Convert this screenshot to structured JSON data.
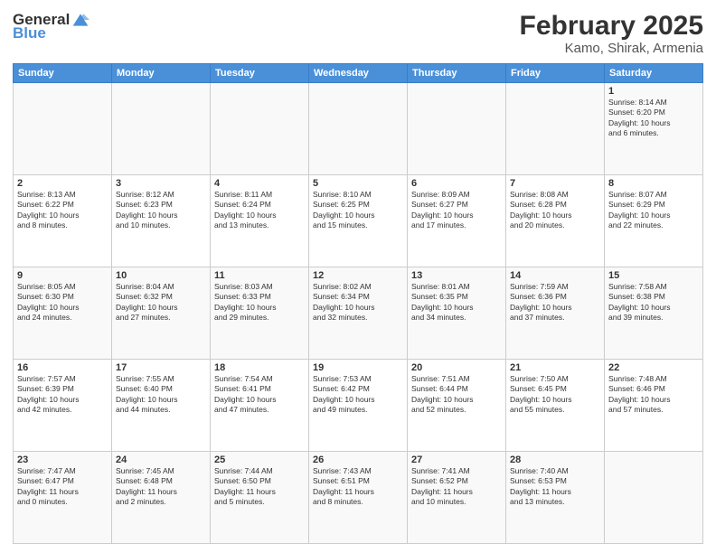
{
  "header": {
    "logo_general": "General",
    "logo_blue": "Blue",
    "title": "February 2025",
    "subtitle": "Kamo, Shirak, Armenia"
  },
  "days_of_week": [
    "Sunday",
    "Monday",
    "Tuesday",
    "Wednesday",
    "Thursday",
    "Friday",
    "Saturday"
  ],
  "weeks": [
    [
      {
        "day": "",
        "info": ""
      },
      {
        "day": "",
        "info": ""
      },
      {
        "day": "",
        "info": ""
      },
      {
        "day": "",
        "info": ""
      },
      {
        "day": "",
        "info": ""
      },
      {
        "day": "",
        "info": ""
      },
      {
        "day": "1",
        "info": "Sunrise: 8:14 AM\nSunset: 6:20 PM\nDaylight: 10 hours\nand 6 minutes."
      }
    ],
    [
      {
        "day": "2",
        "info": "Sunrise: 8:13 AM\nSunset: 6:22 PM\nDaylight: 10 hours\nand 8 minutes."
      },
      {
        "day": "3",
        "info": "Sunrise: 8:12 AM\nSunset: 6:23 PM\nDaylight: 10 hours\nand 10 minutes."
      },
      {
        "day": "4",
        "info": "Sunrise: 8:11 AM\nSunset: 6:24 PM\nDaylight: 10 hours\nand 13 minutes."
      },
      {
        "day": "5",
        "info": "Sunrise: 8:10 AM\nSunset: 6:25 PM\nDaylight: 10 hours\nand 15 minutes."
      },
      {
        "day": "6",
        "info": "Sunrise: 8:09 AM\nSunset: 6:27 PM\nDaylight: 10 hours\nand 17 minutes."
      },
      {
        "day": "7",
        "info": "Sunrise: 8:08 AM\nSunset: 6:28 PM\nDaylight: 10 hours\nand 20 minutes."
      },
      {
        "day": "8",
        "info": "Sunrise: 8:07 AM\nSunset: 6:29 PM\nDaylight: 10 hours\nand 22 minutes."
      }
    ],
    [
      {
        "day": "9",
        "info": "Sunrise: 8:05 AM\nSunset: 6:30 PM\nDaylight: 10 hours\nand 24 minutes."
      },
      {
        "day": "10",
        "info": "Sunrise: 8:04 AM\nSunset: 6:32 PM\nDaylight: 10 hours\nand 27 minutes."
      },
      {
        "day": "11",
        "info": "Sunrise: 8:03 AM\nSunset: 6:33 PM\nDaylight: 10 hours\nand 29 minutes."
      },
      {
        "day": "12",
        "info": "Sunrise: 8:02 AM\nSunset: 6:34 PM\nDaylight: 10 hours\nand 32 minutes."
      },
      {
        "day": "13",
        "info": "Sunrise: 8:01 AM\nSunset: 6:35 PM\nDaylight: 10 hours\nand 34 minutes."
      },
      {
        "day": "14",
        "info": "Sunrise: 7:59 AM\nSunset: 6:36 PM\nDaylight: 10 hours\nand 37 minutes."
      },
      {
        "day": "15",
        "info": "Sunrise: 7:58 AM\nSunset: 6:38 PM\nDaylight: 10 hours\nand 39 minutes."
      }
    ],
    [
      {
        "day": "16",
        "info": "Sunrise: 7:57 AM\nSunset: 6:39 PM\nDaylight: 10 hours\nand 42 minutes."
      },
      {
        "day": "17",
        "info": "Sunrise: 7:55 AM\nSunset: 6:40 PM\nDaylight: 10 hours\nand 44 minutes."
      },
      {
        "day": "18",
        "info": "Sunrise: 7:54 AM\nSunset: 6:41 PM\nDaylight: 10 hours\nand 47 minutes."
      },
      {
        "day": "19",
        "info": "Sunrise: 7:53 AM\nSunset: 6:42 PM\nDaylight: 10 hours\nand 49 minutes."
      },
      {
        "day": "20",
        "info": "Sunrise: 7:51 AM\nSunset: 6:44 PM\nDaylight: 10 hours\nand 52 minutes."
      },
      {
        "day": "21",
        "info": "Sunrise: 7:50 AM\nSunset: 6:45 PM\nDaylight: 10 hours\nand 55 minutes."
      },
      {
        "day": "22",
        "info": "Sunrise: 7:48 AM\nSunset: 6:46 PM\nDaylight: 10 hours\nand 57 minutes."
      }
    ],
    [
      {
        "day": "23",
        "info": "Sunrise: 7:47 AM\nSunset: 6:47 PM\nDaylight: 11 hours\nand 0 minutes."
      },
      {
        "day": "24",
        "info": "Sunrise: 7:45 AM\nSunset: 6:48 PM\nDaylight: 11 hours\nand 2 minutes."
      },
      {
        "day": "25",
        "info": "Sunrise: 7:44 AM\nSunset: 6:50 PM\nDaylight: 11 hours\nand 5 minutes."
      },
      {
        "day": "26",
        "info": "Sunrise: 7:43 AM\nSunset: 6:51 PM\nDaylight: 11 hours\nand 8 minutes."
      },
      {
        "day": "27",
        "info": "Sunrise: 7:41 AM\nSunset: 6:52 PM\nDaylight: 11 hours\nand 10 minutes."
      },
      {
        "day": "28",
        "info": "Sunrise: 7:40 AM\nSunset: 6:53 PM\nDaylight: 11 hours\nand 13 minutes."
      },
      {
        "day": "",
        "info": ""
      }
    ]
  ]
}
